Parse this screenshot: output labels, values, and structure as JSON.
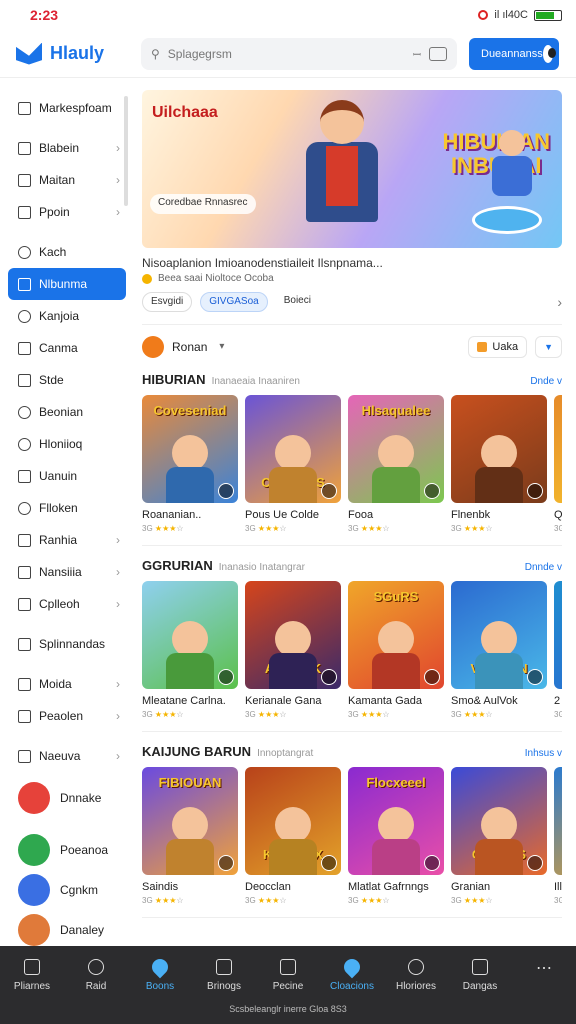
{
  "status": {
    "time": "2:23",
    "right": "il ıl40C"
  },
  "app": {
    "name": "Hlauly"
  },
  "search": {
    "placeholder": "Splagegrsm",
    "mid": "ꟷ"
  },
  "header": {
    "cta_label": "Dueannanss"
  },
  "sidebar": {
    "items": [
      {
        "label": "Markespfoam"
      },
      {
        "label": "Blabein"
      },
      {
        "label": "Maitan"
      },
      {
        "label": "Ppoin"
      },
      {
        "label": "Kach"
      },
      {
        "label": "Nlbunma"
      },
      {
        "label": "Kanjoia"
      },
      {
        "label": "Canma"
      },
      {
        "label": "Stde"
      },
      {
        "label": "Beonian"
      },
      {
        "label": "Hloniioq"
      },
      {
        "label": "Uanuin"
      },
      {
        "label": "Flloken"
      },
      {
        "label": "Ranhia"
      },
      {
        "label": "Nansiiia"
      },
      {
        "label": "Cplleoh"
      },
      {
        "label": "Splinnandas"
      },
      {
        "label": "Moida"
      },
      {
        "label": "Peaolen"
      },
      {
        "label": "Naeuva"
      }
    ],
    "apps": [
      {
        "label": "Dnnake",
        "color": "#e6423a"
      },
      {
        "label": "Poeanoa",
        "color": "#2fa84f"
      },
      {
        "label": "Cgnkm",
        "color": "#3a6fe3"
      },
      {
        "label": "Danaley",
        "color": "#e07a3a"
      }
    ]
  },
  "banner": {
    "title": "Uilchaaa",
    "headline_1": "HIBUKIAN",
    "headline_2": "INBUSAI",
    "chip": "Coredbae Rnnasrec",
    "desc": "Nisoaplanion Imioanodenstiaileit Ilsnpnama...",
    "meta": "Beea saai Nioltoce Ocoba",
    "tags": [
      "Esvgidi",
      "GIVGASoa",
      "Boieci"
    ]
  },
  "filter": {
    "label": "Ronan",
    "btn1": "Uaka",
    "btn2": ""
  },
  "sections": [
    {
      "title": "HIBURIAN",
      "subtitle": "Inanaeaia Inaaniren",
      "more": "Dnde v",
      "cards": [
        {
          "thumb_title": "Coveseniad",
          "name": "Roananian..",
          "rating": "3G",
          "c1": "#e98a3a",
          "c2": "#3b83d8"
        },
        {
          "thumb_title": "CUADALS",
          "name": "Pous Ue Colde",
          "rating": "3G",
          "c1": "#6a54d6",
          "c2": "#f0a23a"
        },
        {
          "thumb_title": "Hlsaqualee",
          "name": "Fooa",
          "rating": "3G",
          "c1": "#e565b8",
          "c2": "#7cc84f"
        },
        {
          "thumb_title": "",
          "name": "Flnenbk",
          "rating": "3G",
          "c1": "#c8501e",
          "c2": "#7a3b1b"
        },
        {
          "thumb_title": "",
          "name": "Q",
          "rating": "3G",
          "c1": "#e68a2a",
          "c2": "#f7c72e"
        }
      ]
    },
    {
      "title": "GGRURIAN",
      "subtitle": "Inanasio Inatangrar",
      "more": "Dnnde v",
      "cards": [
        {
          "thumb_title": "",
          "name": "Mleatane Carlna.",
          "rating": "3G",
          "c1": "#8fd0ef",
          "c2": "#5bc04a"
        },
        {
          "thumb_title": "ADBUAK",
          "name": "Kerianale Gana",
          "rating": "3G",
          "c1": "#d6451b",
          "c2": "#3a2a6a"
        },
        {
          "thumb_title": "SGuRS",
          "name": "Kamanta Gada",
          "rating": "3G",
          "c1": "#f0a62a",
          "c2": "#e0452e"
        },
        {
          "thumb_title": "VIIURIAN",
          "name": "Smo& AulVok",
          "rating": "3G",
          "c1": "#2b6ad0",
          "c2": "#4ab8e8"
        },
        {
          "thumb_title": "",
          "name": "2",
          "rating": "3G",
          "c1": "#1f8ed0",
          "c2": "#2b6ad0"
        }
      ]
    },
    {
      "title": "KAIJUNG BARUN",
      "subtitle": "Innoptangrat",
      "more": "Inhsus v",
      "cards": [
        {
          "thumb_title": "FIBIOUAN",
          "name": "Saindis",
          "rating": "3G",
          "c1": "#6a4ae0",
          "c2": "#f0a23a"
        },
        {
          "thumb_title": "KOIBRAX",
          "name": "Deocclan",
          "rating": "3G",
          "c1": "#b8421a",
          "c2": "#e3a22a"
        },
        {
          "thumb_title": "Flocxeeel",
          "name": "Mlatlat Gafrnngs",
          "rating": "3G",
          "c1": "#8a2ad0",
          "c2": "#e94fa8"
        },
        {
          "thumb_title": "CANSES",
          "name": "Granian",
          "rating": "3G",
          "c1": "#3a4ad8",
          "c2": "#e86a2a"
        },
        {
          "thumb_title": "",
          "name": "Ill",
          "rating": "3G",
          "c1": "#2a7ad0",
          "c2": "#e8a22a"
        }
      ]
    }
  ],
  "bottom_nav": {
    "tabs": [
      {
        "label": "Pliarnes"
      },
      {
        "label": "Raid"
      },
      {
        "label": "Boons"
      },
      {
        "label": "Brinogs"
      },
      {
        "label": "Pecine"
      },
      {
        "label": "Cloacions"
      },
      {
        "label": "Hloriores"
      },
      {
        "label": "Dangas"
      },
      {
        "label": ""
      }
    ],
    "footer": "Scsbeleanglr inerre Gloa 8S3"
  }
}
